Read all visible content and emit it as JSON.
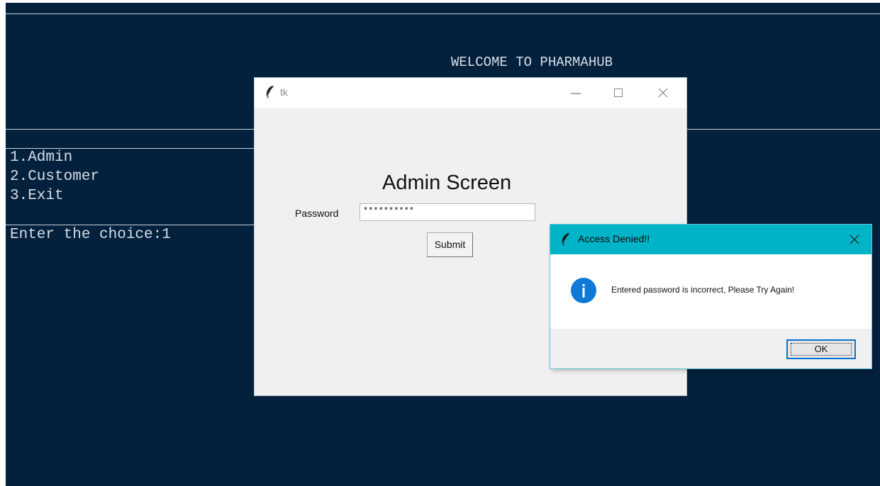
{
  "terminal": {
    "welcome": "WELCOME TO PHARMAHUB",
    "menu": [
      "1.Admin",
      "2.Customer",
      "3.Exit"
    ],
    "prompt": "Enter the choice:1"
  },
  "tk_window": {
    "title": "tk",
    "heading": "Admin Screen",
    "password_label": "Password",
    "password_value": "**********",
    "submit_label": "Submit",
    "icons": [
      "feather-icon",
      "minimize-icon",
      "maximize-icon",
      "close-icon"
    ]
  },
  "dialog": {
    "title": "Access Denied!!",
    "message": "Entered password is incorrect, Please Try Again!",
    "ok_label": "OK",
    "icons": [
      "feather-icon",
      "info-icon",
      "close-icon"
    ]
  },
  "colors": {
    "terminal_bg": "#03203c",
    "dialog_titlebar": "#00b4c8",
    "info_icon": "#0f7ad6"
  }
}
